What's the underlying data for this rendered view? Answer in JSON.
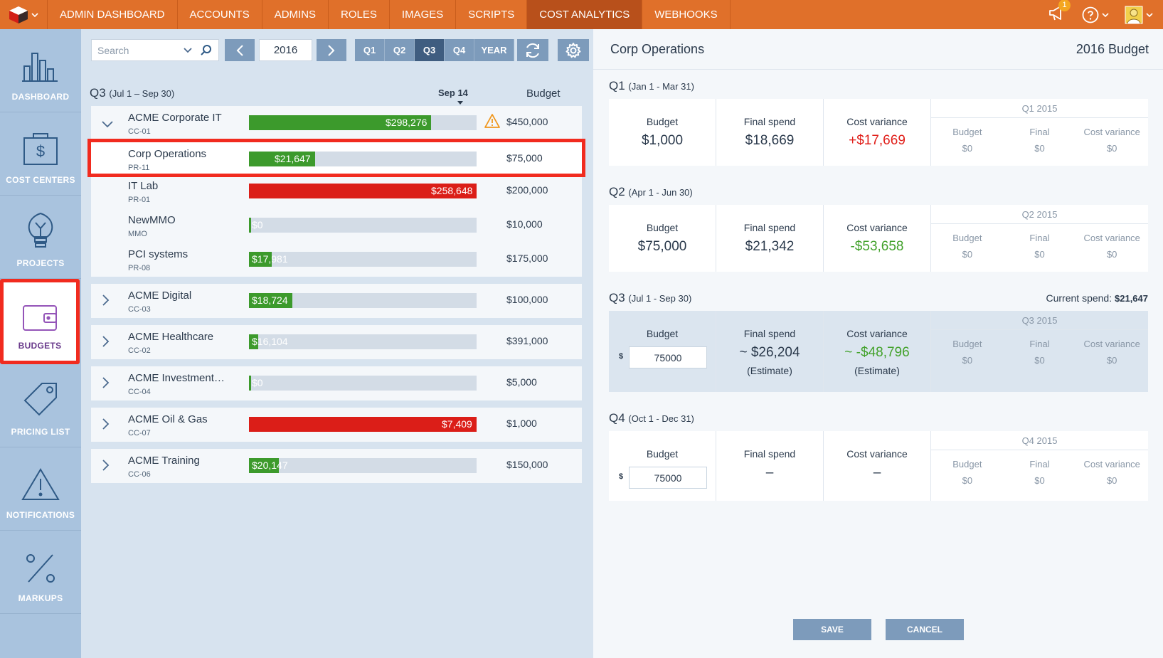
{
  "nav": {
    "items": [
      "ADMIN DASHBOARD",
      "ACCOUNTS",
      "ADMINS",
      "ROLES",
      "IMAGES",
      "SCRIPTS",
      "COST ANALYTICS",
      "WEBHOOKS"
    ],
    "active": "COST ANALYTICS",
    "notification_count": "1"
  },
  "sidebar": {
    "items": [
      {
        "label": "DASHBOARD",
        "icon": "bar-chart-icon"
      },
      {
        "label": "COST CENTERS",
        "icon": "dollar-folder-icon"
      },
      {
        "label": "PROJECTS",
        "icon": "lightbulb-icon"
      },
      {
        "label": "BUDGETS",
        "icon": "wallet-icon"
      },
      {
        "label": "PRICING LIST",
        "icon": "price-tag-icon"
      },
      {
        "label": "NOTIFICATIONS",
        "icon": "warning-icon"
      },
      {
        "label": "MARKUPS",
        "icon": "percent-icon"
      }
    ],
    "active": "BUDGETS"
  },
  "toolbar": {
    "search_placeholder": "Search",
    "year": "2016",
    "quarters": [
      "Q1",
      "Q2",
      "Q3",
      "Q4",
      "YEAR"
    ],
    "selected_quarter": "Q3"
  },
  "list": {
    "quarter": "Q3",
    "range": "(Jul 1 – Sep 30)",
    "marker": "Sep 14",
    "budget_header": "Budget"
  },
  "cost_centers": [
    {
      "name": "ACME Corporate IT",
      "code": "CC-01",
      "spend": "$298,276",
      "fraction": 0.8,
      "status": "green",
      "budget": "$450,000",
      "warning": true,
      "expanded": true,
      "projects": [
        {
          "name": "Corp Operations",
          "code": "PR-11",
          "spend": "$21,647",
          "fraction": 0.29,
          "status": "green",
          "budget": "$75,000",
          "selected": true
        },
        {
          "name": "IT Lab",
          "code": "PR-01",
          "spend": "$258,648",
          "fraction": 1.0,
          "status": "red",
          "budget": "$200,000"
        },
        {
          "name": "NewMMO",
          "code": "MMO",
          "spend": "$0",
          "fraction": 0.0,
          "status": "green",
          "budget": "$10,000"
        },
        {
          "name": "PCI systems",
          "code": "PR-08",
          "spend": "$17,981",
          "fraction": 0.1,
          "status": "green",
          "budget": "$175,000"
        }
      ]
    },
    {
      "name": "ACME Digital",
      "code": "CC-03",
      "spend": "$18,724",
      "fraction": 0.19,
      "status": "green",
      "budget": "$100,000"
    },
    {
      "name": "ACME Healthcare",
      "code": "CC-02",
      "spend": "$16,104",
      "fraction": 0.04,
      "status": "green",
      "budget": "$391,000"
    },
    {
      "name": "ACME Investment…",
      "code": "CC-04",
      "spend": "$0",
      "fraction": 0.0,
      "status": "green",
      "budget": "$5,000"
    },
    {
      "name": "ACME Oil & Gas",
      "code": "CC-07",
      "spend": "$7,409",
      "fraction": 1.0,
      "status": "red",
      "budget": "$1,000"
    },
    {
      "name": "ACME Training",
      "code": "CC-06",
      "spend": "$20,147",
      "fraction": 0.13,
      "status": "green",
      "budget": "$150,000"
    }
  ],
  "detail": {
    "title": "Corp Operations",
    "budget_year": "2016 Budget",
    "labels": {
      "budget": "Budget",
      "final": "Final spend",
      "variance": "Cost variance",
      "prev_final": "Final",
      "estimate": "(Estimate)",
      "current_spend": "Current spend:"
    },
    "quarters": [
      {
        "q": "Q1",
        "range": "(Jan 1 - Mar 31)",
        "budget": "$1,000",
        "final": "$18,669",
        "variance": "+$17,669",
        "variance_color": "red",
        "prev_title": "Q1 2015",
        "prev_budget": "$0",
        "prev_final": "$0",
        "prev_variance": "$0"
      },
      {
        "q": "Q2",
        "range": "(Apr 1 - Jun 30)",
        "budget": "$75,000",
        "final": "$21,342",
        "variance": "-$53,658",
        "variance_color": "green",
        "prev_title": "Q2 2015",
        "prev_budget": "$0",
        "prev_final": "$0",
        "prev_variance": "$0"
      },
      {
        "q": "Q3",
        "range": "(Jul 1 - Sep 30)",
        "budget_input": "75000",
        "final": "~ $26,204",
        "variance": "~ -$48,796",
        "variance_color": "green",
        "current_spend": "$21,647",
        "prev_title": "Q3 2015",
        "prev_budget": "$0",
        "prev_final": "$0",
        "prev_variance": "$0"
      },
      {
        "q": "Q4",
        "range": "(Oct 1 - Dec 31)",
        "budget_input": "75000",
        "final": "–",
        "variance": "–",
        "prev_title": "Q4 2015",
        "prev_budget": "$0",
        "prev_final": "$0",
        "prev_variance": "$0"
      }
    ],
    "currency_symbol": "$",
    "save_label": "SAVE",
    "cancel_label": "CANCEL"
  }
}
